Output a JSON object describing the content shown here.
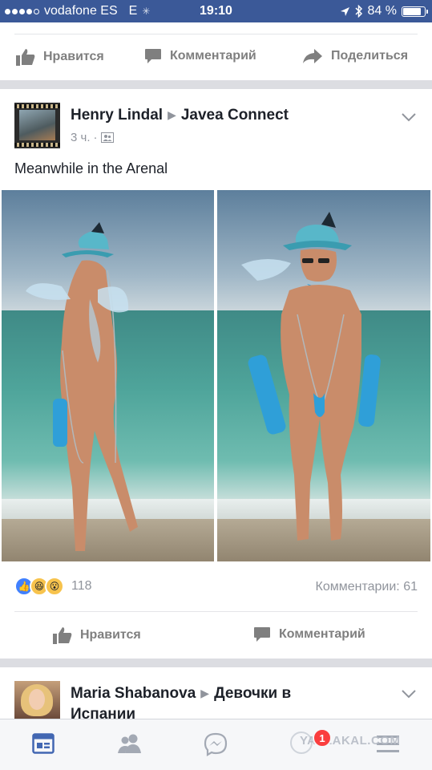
{
  "status_bar": {
    "carrier": "vodafone ES",
    "network": "E",
    "time": "19:10",
    "battery_percent": "84 %",
    "battery_level": 0.84,
    "signal_bars_filled": 4,
    "signal_bars_total": 5
  },
  "previous_post_actions": {
    "like_label": "Нравится",
    "comment_label": "Комментарий",
    "share_label": "Поделиться"
  },
  "post": {
    "author": "Henry Lindal",
    "group": "Javea Connect",
    "time": "3 ч.",
    "text": "Meanwhile in the Arenal",
    "reaction_count": "118",
    "comments": "Комментарии: 61",
    "like_label": "Нравится",
    "comment_label": "Комментарий"
  },
  "next_post": {
    "author": "Maria Shabanova",
    "group": "Девочки в Испании"
  },
  "tabbar": {
    "badge_count": "1",
    "watermark": "YAPLAKAL.COM"
  },
  "colors": {
    "brand": "#3b5998",
    "active_tab": "#4267b2",
    "like_reaction": "#4080ff",
    "muted": "#90949c",
    "badge": "#fa3e3e"
  }
}
